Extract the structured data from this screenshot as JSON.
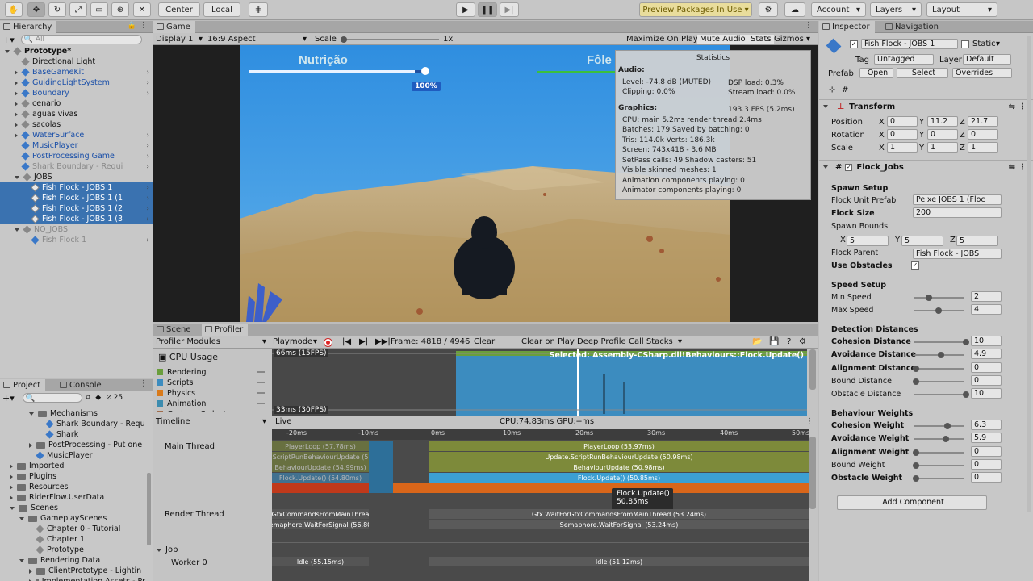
{
  "toolbar": {
    "center": "Center",
    "local": "Local",
    "preview": "Preview Packages In Use",
    "account": "Account",
    "layers": "Layers",
    "layout": "Layout"
  },
  "hierarchy": {
    "tab": "Hierarchy",
    "search_placeholder": "All",
    "items": [
      {
        "label": "Prototype*",
        "depth": 0,
        "open": true,
        "icon": "unity-scene",
        "bold": true
      },
      {
        "label": "Directional Light",
        "depth": 1,
        "icon": "cube-grey"
      },
      {
        "label": "BaseGameKit",
        "depth": 1,
        "icon": "cube-blue",
        "blue": true,
        "closed": true,
        "chev": true
      },
      {
        "label": "GuidingLightSystem",
        "depth": 1,
        "icon": "cube-blue",
        "blue": true,
        "closed": true,
        "chev": true
      },
      {
        "label": "Boundary",
        "depth": 1,
        "icon": "cube-blue",
        "blue": true,
        "closed": true,
        "chev": true
      },
      {
        "label": "cenario",
        "depth": 1,
        "icon": "cube-grey",
        "closed": true
      },
      {
        "label": "aguas vivas",
        "depth": 1,
        "icon": "cube-grey",
        "closed": true
      },
      {
        "label": "sacolas",
        "depth": 1,
        "icon": "cube-grey",
        "closed": true
      },
      {
        "label": "WaterSurface",
        "depth": 1,
        "icon": "cube-blue",
        "blue": true,
        "closed": true,
        "chev": true
      },
      {
        "label": "MusicPlayer",
        "depth": 1,
        "icon": "cube-blue",
        "blue": true,
        "chev": true
      },
      {
        "label": "PostProcessing Game",
        "depth": 1,
        "icon": "cube-blue",
        "blue": true,
        "chev": true
      },
      {
        "label": "Shark Boundary - Requi",
        "depth": 1,
        "icon": "cube-blue",
        "grey": true,
        "chev": true
      },
      {
        "label": "JOBS",
        "depth": 1,
        "icon": "cube-grey",
        "open": true
      },
      {
        "label": "Fish Flock - JOBS 1",
        "depth": 2,
        "icon": "cube-white",
        "sel": true,
        "chev": true
      },
      {
        "label": "Fish Flock - JOBS 1 (1",
        "depth": 2,
        "icon": "cube-white",
        "sel": true,
        "chev": true
      },
      {
        "label": "Fish Flock - JOBS 1 (2",
        "depth": 2,
        "icon": "cube-white",
        "sel": true,
        "chev": true
      },
      {
        "label": "Fish Flock - JOBS 1 (3",
        "depth": 2,
        "icon": "cube-white",
        "sel": true,
        "chev": true
      },
      {
        "label": "NO_JOBS",
        "depth": 1,
        "icon": "cube-grey",
        "grey": true,
        "open": true
      },
      {
        "label": "Fish Flock 1",
        "depth": 2,
        "icon": "cube-blue",
        "grey": true,
        "chev": true
      }
    ]
  },
  "project": {
    "tab": "Project",
    "console_tab": "Console",
    "count": "25",
    "items": [
      {
        "label": "Mechanisms",
        "depth": 2,
        "open": true,
        "folder": true
      },
      {
        "label": "Shark Boundary - Requ",
        "depth": 3,
        "icon": "cube-blue"
      },
      {
        "label": "Shark",
        "depth": 3,
        "icon": "cube-blue"
      },
      {
        "label": "PostProcessing - Put one",
        "depth": 2,
        "folder": true,
        "closed": true
      },
      {
        "label": "MusicPlayer",
        "depth": 2,
        "icon": "cube-blue"
      },
      {
        "label": "Imported",
        "depth": 0,
        "folder": true,
        "closed": true
      },
      {
        "label": "Plugins",
        "depth": 0,
        "folder": true,
        "closed": true
      },
      {
        "label": "Resources",
        "depth": 0,
        "folder": true,
        "closed": true
      },
      {
        "label": "RiderFlow.UserData",
        "depth": 0,
        "folder": true,
        "closed": true
      },
      {
        "label": "Scenes",
        "depth": 0,
        "folder": true,
        "open": true
      },
      {
        "label": "GameplayScenes",
        "depth": 1,
        "folder": true,
        "open": true
      },
      {
        "label": "Chapter 0 - Tutorial",
        "depth": 2,
        "icon": "unity-scene"
      },
      {
        "label": "Chapter 1",
        "depth": 2,
        "icon": "unity-scene"
      },
      {
        "label": "Prototype",
        "depth": 2,
        "icon": "unity-scene"
      },
      {
        "label": "Rendering Data",
        "depth": 1,
        "folder": true,
        "open": true
      },
      {
        "label": "ClientPrototype - Lightin",
        "depth": 2,
        "folder": true,
        "closed": true
      },
      {
        "label": "Implementation Assets - Pr",
        "depth": 2,
        "folder": true,
        "closed": true
      }
    ]
  },
  "game": {
    "tab": "Game",
    "display": "Display 1",
    "aspect": "16:9 Aspect",
    "scale_label": "Scale",
    "scale_value": "1x",
    "maximize": "Maximize On Play",
    "mute": "Mute Audio",
    "stats": "Stats",
    "gizmos": "Gizmos",
    "hud": {
      "nutricao": "Nutrição",
      "folego": "Fôle",
      "pct": "100%",
      "nutricao_level": 0.93
    },
    "stats_panel": {
      "title": "Statistics",
      "audio": "Audio:",
      "level": "Level: -74.8 dB (MUTED)",
      "dsp": "DSP load: 0.3%",
      "clipping": "Clipping: 0.0%",
      "stream": "Stream load: 0.0%",
      "graphics": "Graphics:",
      "fps": "193.3 FPS (5.2ms)",
      "cpu": "CPU: main 5.2ms  render thread 2.4ms",
      "batches": "Batches: 179   Saved by batching: 0",
      "tris": "Tris: 114.0k        Verts: 186.3k",
      "screen": "Screen: 743x418 - 3.6 MB",
      "setpass": "SetPass calls: 49         Shadow casters: 51",
      "skinned": "Visible skinned meshes: 1",
      "anim": "Animation components playing: 0",
      "animator": "Animator components playing: 0"
    }
  },
  "profiler": {
    "scene_tab": "Scene",
    "tab": "Profiler",
    "modules": "Profiler Modules",
    "playmode": "Playmode",
    "frame": "Frame: 4818 / 4946",
    "clear": "Clear",
    "clear_on_play": "Clear on Play",
    "deep": "Deep Profile",
    "callstacks": "Call Stacks",
    "cpu_title": "CPU Usage",
    "legend": [
      "Rendering",
      "Scripts",
      "Physics",
      "Animation",
      "GarbageCollector"
    ],
    "legend_colors": [
      "#6a9e3c",
      "#3c8cbf",
      "#d97a1a",
      "#3c8caf",
      "#a06c4b"
    ],
    "fps66": "66ms (15FPS)",
    "fps33": "33ms (30FPS)",
    "selected": "Selected: Assembly-CSharp.dll!Behaviours::Flock.Update()",
    "timeline": "Timeline",
    "live": "Live",
    "cpu_ms": "CPU:74.83ms  GPU:--ms",
    "ticks": [
      "-20ms",
      "-10ms",
      "0ms",
      "10ms",
      "20ms",
      "30ms",
      "40ms",
      "50ms"
    ],
    "main_thread": "Main Thread",
    "render_thread": "Render Thread",
    "job": "Job",
    "worker": "Worker 0",
    "bars": {
      "playerloop_prev": "PlayerLoop (57.78ms)",
      "playerloop": "PlayerLoop (53.97ms)",
      "scriptrun_prev": "ScriptRunBehaviourUpdate (5",
      "scriptrun": "Update.ScriptRunBehaviourUpdate (50.98ms)",
      "behav_prev": "BehaviourUpdate (54.99ms)",
      "behav": "BehaviourUpdate (50.98ms)",
      "flock_prev": "Flock.Update() (54.80ms)",
      "flock": "Flock.Update() (50.85ms)",
      "gfx_prev": "GfxCommandsFromMainThrea",
      "gfx": "Gfx.WaitForGfxCommandsFromMainThread (53.24ms)",
      "sema_prev": "Semaphore.WaitForSignal (56.80n",
      "sema": "Semaphore.WaitForSignal (53.24ms)",
      "idle_prev": "Idle (55.15ms)",
      "idle": "Idle (51.12ms)"
    },
    "tooltip_name": "Flock.Update()",
    "tooltip_ms": "50.85ms"
  },
  "inspector": {
    "tab": "Inspector",
    "nav_tab": "Navigation",
    "name": "Fish Flock - JOBS 1",
    "static": "Static",
    "tag_label": "Tag",
    "tag": "Untagged",
    "layer_label": "Layer",
    "layer": "Default",
    "prefab_label": "Prefab",
    "open": "Open",
    "select": "Select",
    "overrides": "Overrides",
    "transform": "Transform",
    "position": "Position",
    "rotation": "Rotation",
    "scale": "Scale",
    "pos": [
      "0",
      "11.2",
      "21.7"
    ],
    "rot": [
      "0",
      "0",
      "0"
    ],
    "scl": [
      "1",
      "1",
      "1"
    ],
    "component": "Flock_Jobs",
    "spawn_setup": "Spawn Setup",
    "unit_prefab_label": "Flock Unit Prefab",
    "unit_prefab": "Peixe JOBS 1 (Floc",
    "flock_size_label": "Flock Size",
    "flock_size": "200",
    "spawn_bounds": "Spawn Bounds",
    "bounds": [
      "5",
      "5",
      "5"
    ],
    "parent_label": "Flock Parent",
    "parent": "Fish Flock - JOBS",
    "use_obstacles": "Use Obstacles",
    "speed_setup": "Speed Setup",
    "min_speed_label": "Min Speed",
    "min_speed": "2",
    "max_speed_label": "Max Speed",
    "max_speed": "4",
    "detection": "Detection Distances",
    "cohesion_dist_label": "Cohesion Distance",
    "cohesion_dist": "10",
    "avoid_dist_label": "Avoidance Distance",
    "avoid_dist": "4.9",
    "align_dist_label": "Alignment Distance",
    "align_dist": "0",
    "bound_dist_label": "Bound Distance",
    "bound_dist": "0",
    "obstacle_dist_label": "Obstacle Distance",
    "obstacle_dist": "10",
    "weights": "Behaviour Weights",
    "cohesion_w_label": "Cohesion Weight",
    "cohesion_w": "6.3",
    "avoid_w_label": "Avoidance Weight",
    "avoid_w": "5.9",
    "align_w_label": "Alignment Weight",
    "align_w": "0",
    "bound_w_label": "Bound Weight",
    "bound_w": "0",
    "obstacle_w_label": "Obstacle Weight",
    "obstacle_w": "0",
    "add_component": "Add Component"
  }
}
